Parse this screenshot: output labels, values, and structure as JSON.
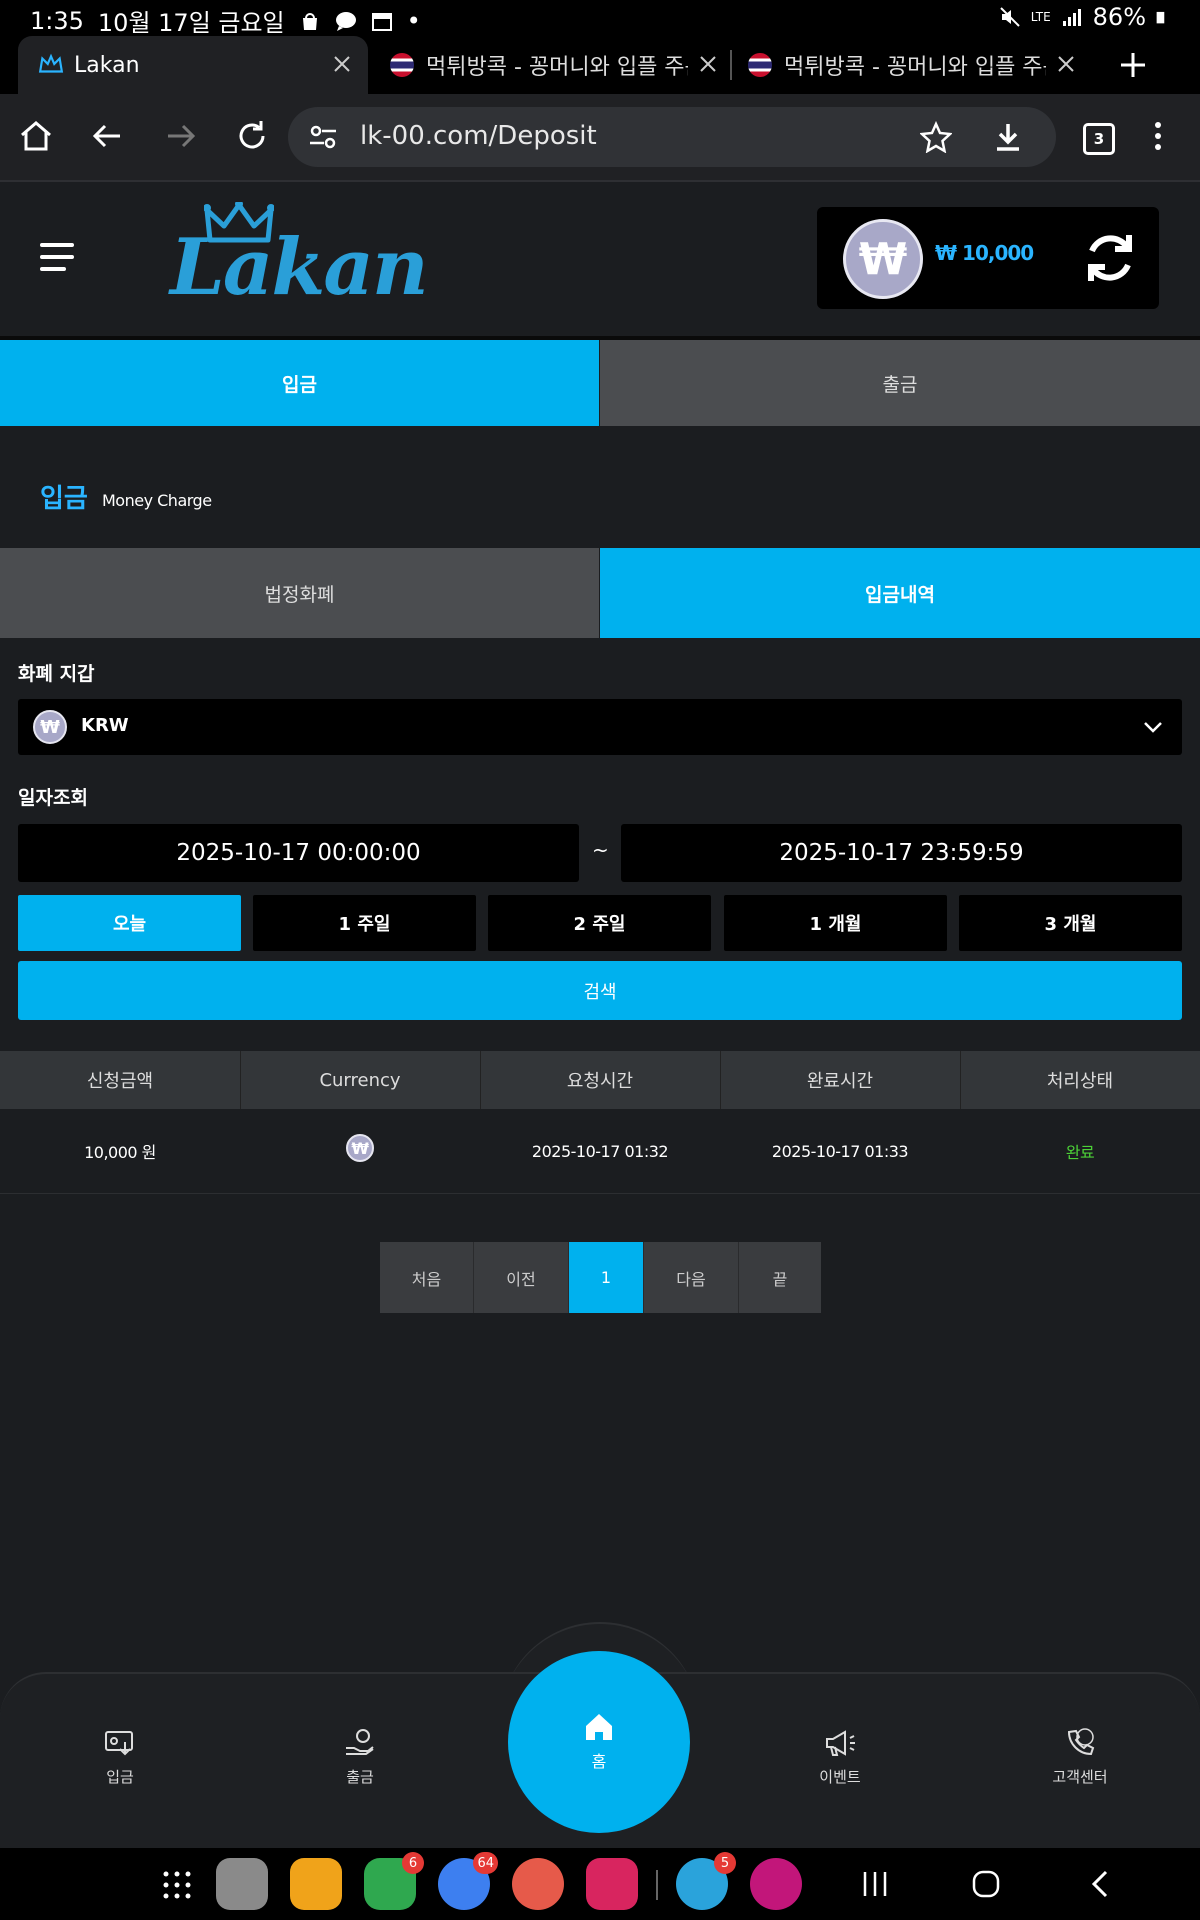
{
  "status_bar": {
    "time": "1:35",
    "date": "10월 17일 금요일",
    "network": "LTE",
    "battery": "86%"
  },
  "browser": {
    "tabs": [
      {
        "title": "Lakan",
        "active": true
      },
      {
        "title": "먹튀방콕 - 꽁머니와 입플 주는",
        "active": false
      },
      {
        "title": "먹튀방콕 - 꽁머니와 입플 주는",
        "active": false
      }
    ],
    "url": "lk-00.com/Deposit",
    "tab_count": "3"
  },
  "site": {
    "logo_text": "Lakan",
    "wallet_symbol": "₩",
    "wallet_balance": "₩ 10,000"
  },
  "main_tabs": [
    {
      "label": "입금",
      "active": true
    },
    {
      "label": "출금",
      "active": false
    }
  ],
  "section": {
    "title": "입금",
    "subtitle": "Money Charge"
  },
  "sub_tabs": [
    {
      "label": "법정화폐",
      "active": false
    },
    {
      "label": "입금내역",
      "active": true
    }
  ],
  "form": {
    "wallet_label": "화폐 지갑",
    "wallet_value": "KRW",
    "date_label": "일자조회",
    "date_from": "2025-10-17 00:00:00",
    "date_sep": "~",
    "date_to": "2025-10-17 23:59:59",
    "periods": [
      "오늘",
      "1 주일",
      "2 주일",
      "1 개월",
      "3 개월"
    ],
    "search_label": "검색"
  },
  "table": {
    "headers": [
      "신청금액",
      "Currency",
      "요청시간",
      "완료시간",
      "처리상태"
    ],
    "rows": [
      {
        "amount": "10,000 원",
        "currency": "₩",
        "request_time": "2025-10-17 01:32",
        "complete_time": "2025-10-17 01:33",
        "status": "완료"
      }
    ]
  },
  "pagination": {
    "first": "처음",
    "prev": "이전",
    "current": "1",
    "next": "다음",
    "last": "끝"
  },
  "bottom_nav": {
    "deposit": "입금",
    "withdraw": "출금",
    "home": "홈",
    "event": "이벤트",
    "support": "고객센터"
  },
  "dock_badges": {
    "phone": "6",
    "messages": "64",
    "telegram": "5"
  },
  "colors": {
    "accent": "#00b1ee",
    "status_done": "#4cd137",
    "balance": "#2ab4ff",
    "background": "#1b1d20"
  }
}
